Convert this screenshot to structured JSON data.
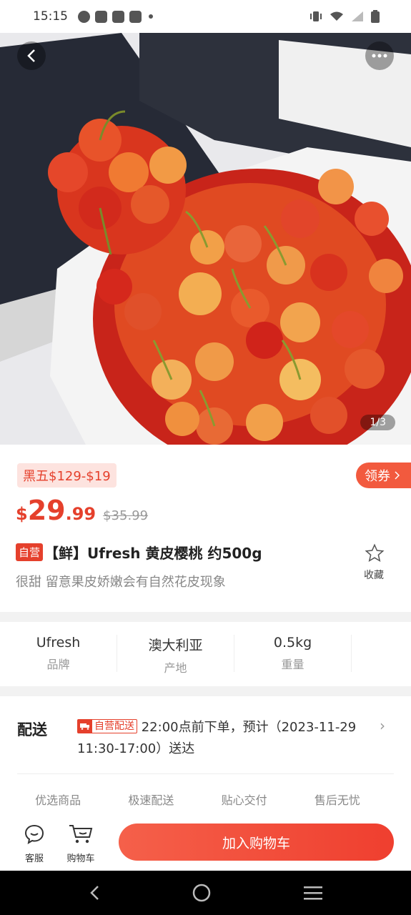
{
  "status_bar": {
    "time": "15:15"
  },
  "hero": {
    "page_indicator": "1/3"
  },
  "promo": {
    "tag": "黑五$129-$19",
    "coupon_label": "领券"
  },
  "price": {
    "currency": "$",
    "integer": "29",
    "decimal": ".99",
    "original": "$35.99"
  },
  "product": {
    "badge": "自营",
    "title": "【鲜】Ufresh 黄皮樱桃 约500g",
    "subtitle": "很甜 留意果皮娇嫩会有自然花皮现象",
    "favorite_label": "收藏"
  },
  "specs": [
    {
      "value": "Ufresh",
      "label": "品牌"
    },
    {
      "value": "澳大利亚",
      "label": "产地"
    },
    {
      "value": "0.5kg",
      "label": "重量"
    }
  ],
  "delivery": {
    "title": "配送",
    "badge": "自营配送",
    "text": "22:00点前下单，预计（2023-11-29 11:30-17:00）送达"
  },
  "guarantees": [
    "优选商品",
    "极速配送",
    "贴心交付",
    "售后无忧"
  ],
  "action_bar": {
    "service_label": "客服",
    "cart_label": "购物车",
    "add_to_cart": "加入购物车"
  },
  "colors": {
    "accent": "#e5402c",
    "coupon": "#f25a3e"
  }
}
